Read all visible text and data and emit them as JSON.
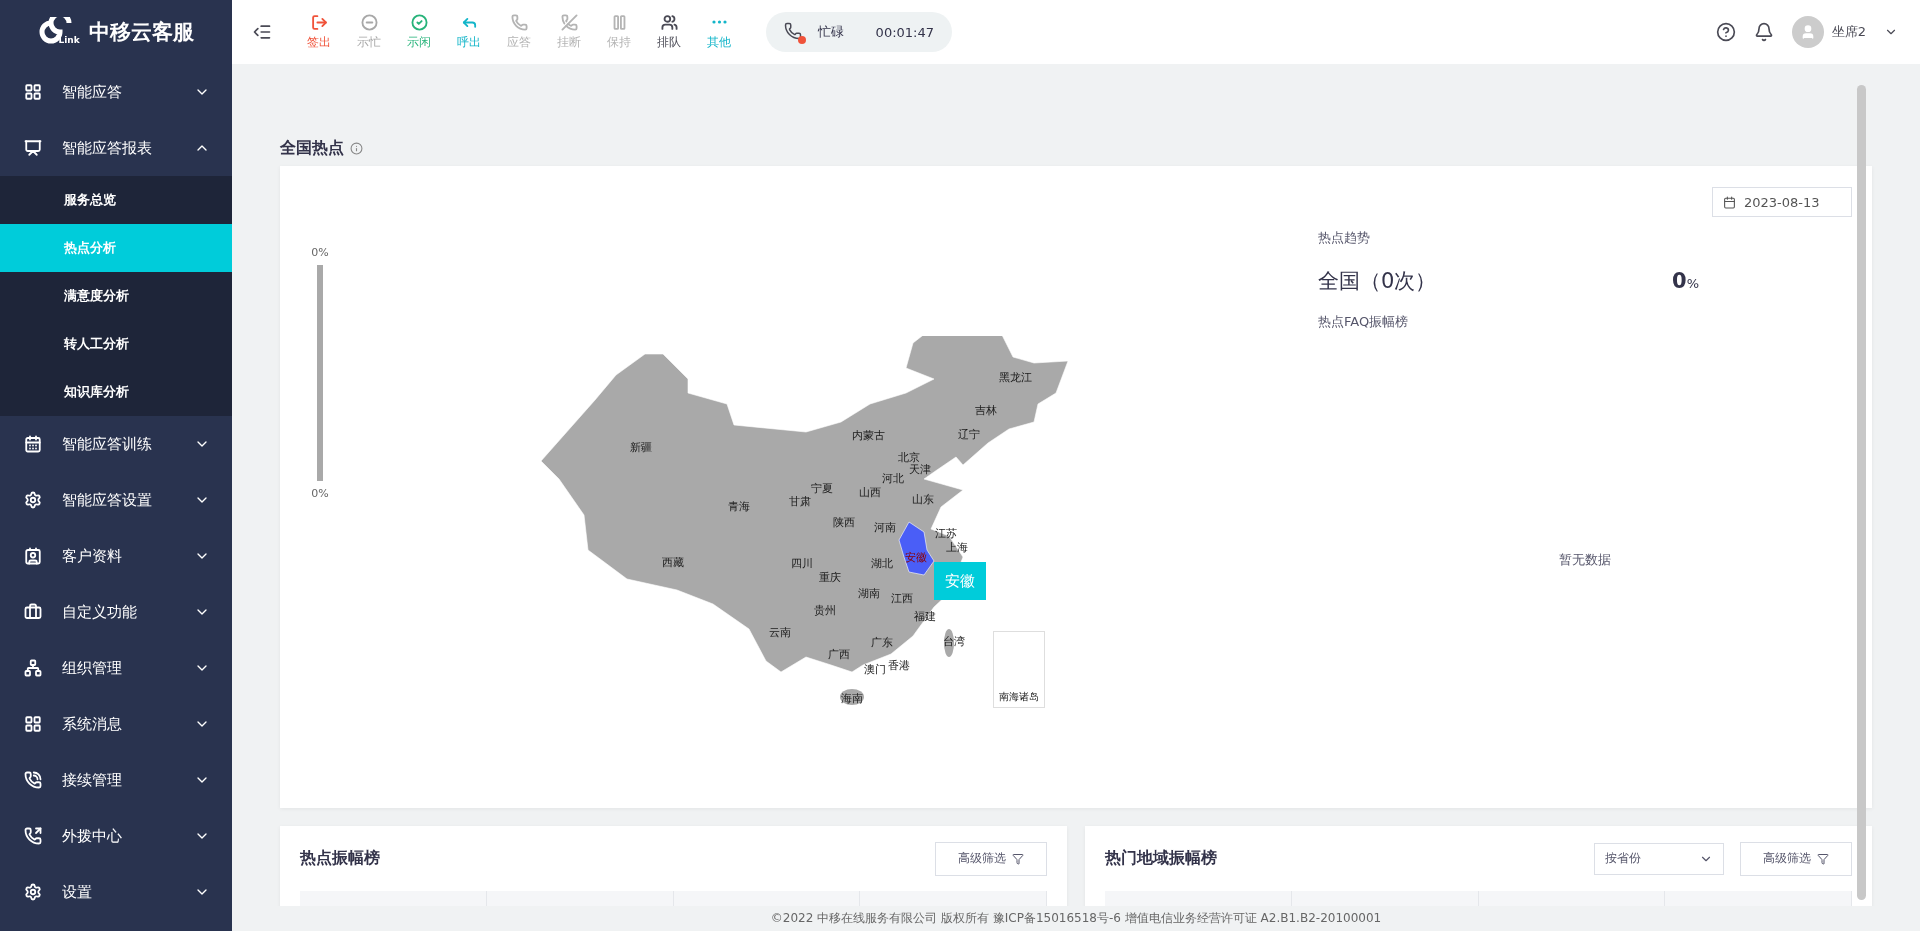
{
  "logo": {
    "text": "中移云客服",
    "sub": "Link"
  },
  "sidebar": {
    "items": [
      {
        "label": "智能应答",
        "expanded": false
      },
      {
        "label": "智能应答报表",
        "expanded": true,
        "children": [
          {
            "label": "服务总览",
            "selected": false
          },
          {
            "label": "热点分析",
            "selected": true
          },
          {
            "label": "满意度分析",
            "selected": false
          },
          {
            "label": "转人工分析",
            "selected": false
          },
          {
            "label": "知识库分析",
            "selected": false
          }
        ]
      },
      {
        "label": "智能应答训练",
        "expanded": false
      },
      {
        "label": "智能应答设置",
        "expanded": false
      },
      {
        "label": "客户资料",
        "expanded": false
      },
      {
        "label": "自定义功能",
        "expanded": false
      },
      {
        "label": "组织管理",
        "expanded": false
      },
      {
        "label": "系统消息",
        "expanded": false
      },
      {
        "label": "接续管理",
        "expanded": false
      },
      {
        "label": "外拨中心",
        "expanded": false
      },
      {
        "label": "设置",
        "expanded": false
      }
    ]
  },
  "toolbar": {
    "actions": [
      {
        "label": "签出",
        "color": "#f0533a"
      },
      {
        "label": "示忙",
        "color": "#a8a8a8"
      },
      {
        "label": "示闲",
        "color": "#27b37a"
      },
      {
        "label": "呼出",
        "color": "#12b5c9"
      },
      {
        "label": "应答",
        "color": "#b4b4b4"
      },
      {
        "label": "挂断",
        "color": "#b4b4b4"
      },
      {
        "label": "保持",
        "color": "#b4b4b4"
      },
      {
        "label": "排队",
        "color": "#4a4a55"
      },
      {
        "label": "其他",
        "color": "#12b5c9"
      }
    ]
  },
  "status": {
    "label": "忙碌",
    "timer": "00:01:47"
  },
  "user": {
    "name": "坐席2"
  },
  "page": {
    "title": "全国热点"
  },
  "map_panel": {
    "visual_map": {
      "max_label": "0%",
      "min_label": "0%"
    },
    "provinces": [
      {
        "label": "新疆",
        "selected": false
      },
      {
        "label": "西藏",
        "selected": false
      },
      {
        "label": "青海",
        "selected": false
      },
      {
        "label": "甘肃",
        "selected": false
      },
      {
        "label": "宁夏",
        "selected": false
      },
      {
        "label": "内蒙古",
        "selected": false
      },
      {
        "label": "黑龙江",
        "selected": false
      },
      {
        "label": "吉林",
        "selected": false
      },
      {
        "label": "辽宁",
        "selected": false
      },
      {
        "label": "北京",
        "selected": false
      },
      {
        "label": "天津",
        "selected": false
      },
      {
        "label": "河北",
        "selected": false
      },
      {
        "label": "山西",
        "selected": false
      },
      {
        "label": "山东",
        "selected": false
      },
      {
        "label": "陕西",
        "selected": false
      },
      {
        "label": "河南",
        "selected": false
      },
      {
        "label": "江苏",
        "selected": false
      },
      {
        "label": "安徽",
        "selected": true
      },
      {
        "label": "上海",
        "selected": false
      },
      {
        "label": "四川",
        "selected": false
      },
      {
        "label": "重庆",
        "selected": false
      },
      {
        "label": "湖北",
        "selected": false
      },
      {
        "label": "湖南",
        "selected": false
      },
      {
        "label": "江西",
        "selected": false
      },
      {
        "label": "贵州",
        "selected": false
      },
      {
        "label": "福建",
        "selected": false
      },
      {
        "label": "台湾",
        "selected": false
      },
      {
        "label": "云南",
        "selected": false
      },
      {
        "label": "广东",
        "selected": false
      },
      {
        "label": "广西",
        "selected": false
      },
      {
        "label": "澳门",
        "selected": false
      },
      {
        "label": "香港",
        "selected": false
      },
      {
        "label": "海南",
        "selected": false
      }
    ],
    "inset_label": "南海诸岛",
    "tooltip": "安徽"
  },
  "trend_panel": {
    "date": "2023-08-13",
    "trend_title": "热点趋势",
    "total": "全国（0次）",
    "percent_value": "0",
    "percent_unit": "%",
    "faq_title": "热点FAQ振幅榜",
    "empty": "暂无数据"
  },
  "bottom_cards": [
    {
      "title": "热点振幅榜",
      "filter_button": "高级筛选"
    },
    {
      "title": "热门地域振幅榜",
      "select": "按省份",
      "filter_button": "高级筛选"
    }
  ],
  "footer": "©2022 中移在线服务有限公司 版权所有 豫ICP备15016518号-6 增值电信业务经营许可证 A2.B1.B2-20100001"
}
